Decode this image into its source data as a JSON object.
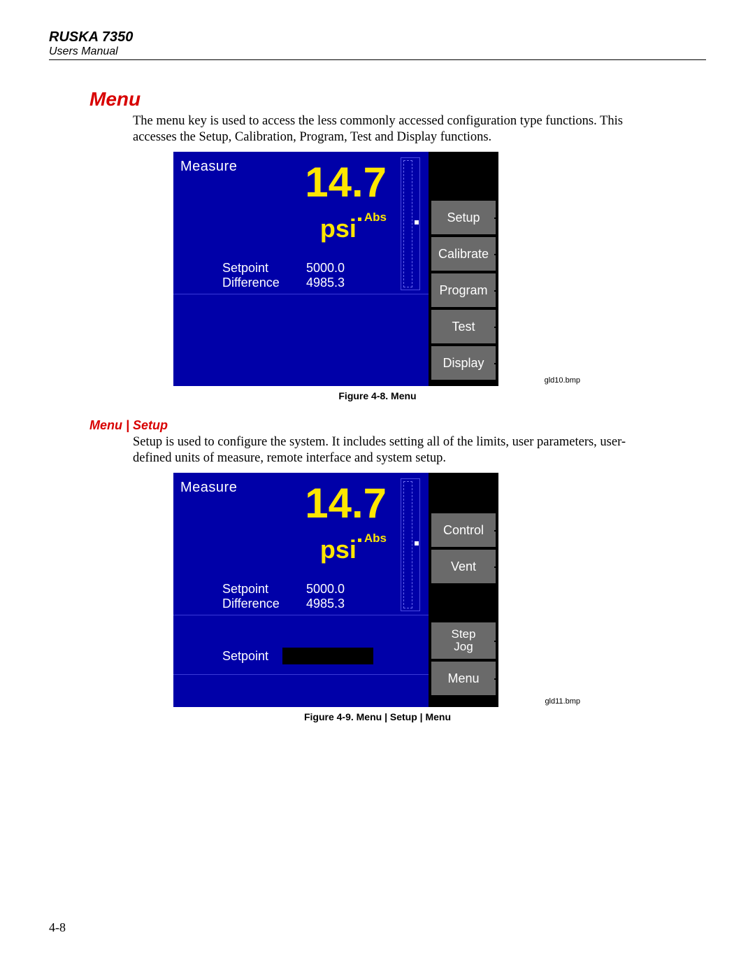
{
  "header": {
    "product": "RUSKA 7350",
    "doc": "Users Manual"
  },
  "sections": {
    "menu_heading": "Menu",
    "menu_text": "The menu key is used to access the less commonly accessed configuration type functions. This accesses the Setup, Calibration, Program, Test and Display functions.",
    "setup_heading": "Menu | Setup",
    "setup_text": "Setup is used to configure the system. It includes setting all of the limits, user parameters, user-defined units of measure, remote interface and system setup."
  },
  "screen1": {
    "mode": "Measure",
    "reading": "14.7",
    "unit_main": "psi",
    "unit_sup": "Abs",
    "label_setpoint": "Setpoint",
    "label_difference": "Difference",
    "val_setpoint": "5000.0",
    "val_difference": "4985.3",
    "softkeys": [
      "Setup",
      "Calibrate",
      "Program",
      "Test",
      "Display"
    ]
  },
  "screen2": {
    "mode": "Measure",
    "reading": "14.7",
    "unit_main": "psi",
    "unit_sup": "Abs",
    "label_setpoint": "Setpoint",
    "label_difference": "Difference",
    "val_setpoint": "5000.0",
    "val_difference": "4985.3",
    "setpoint_row_label": "Setpoint",
    "softkeys": {
      "control": "Control",
      "vent": "Vent",
      "step": "Step",
      "jog": "Jog",
      "menu": "Menu"
    }
  },
  "captions": {
    "fig1": "Figure 4-8. Menu",
    "bmp1": "gld10.bmp",
    "fig2": "Figure 4-9. Menu | Setup | Menu",
    "bmp2": "gld11.bmp"
  },
  "page_number": "4-8"
}
